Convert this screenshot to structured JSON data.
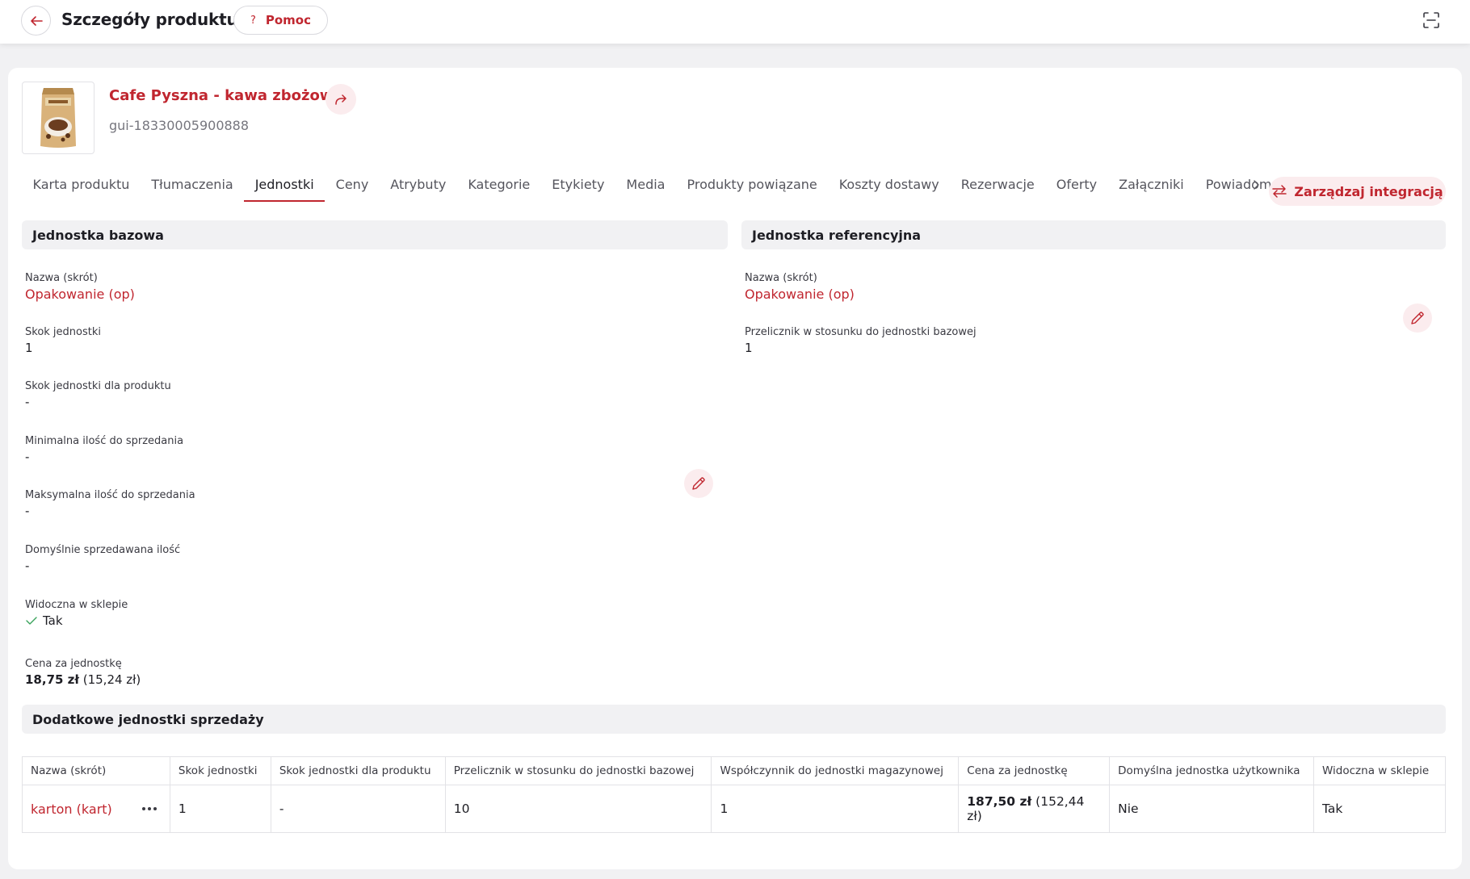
{
  "header": {
    "title": "Szczegóły produktu",
    "help_label": "Pomoc",
    "help_icon_glyph": "?"
  },
  "product": {
    "name": "Cafe Pyszna - kawa zbożowa",
    "code": "gui-18330005900888"
  },
  "tabs": [
    {
      "label": "Karta produktu"
    },
    {
      "label": "Tłumaczenia"
    },
    {
      "label": "Jednostki",
      "active": true
    },
    {
      "label": "Ceny"
    },
    {
      "label": "Atrybuty"
    },
    {
      "label": "Kategorie"
    },
    {
      "label": "Etykiety"
    },
    {
      "label": "Media"
    },
    {
      "label": "Produkty powiązane"
    },
    {
      "label": "Koszty dostawy"
    },
    {
      "label": "Rezerwacje"
    },
    {
      "label": "Oferty"
    },
    {
      "label": "Załączniki"
    },
    {
      "label": "Powiadom"
    }
  ],
  "integration_button": "Zarządzaj integracją",
  "base_unit": {
    "title": "Jednostka bazowa",
    "fields": [
      {
        "label": "Nazwa (skrót)",
        "value": "Opakowanie (op)"
      },
      {
        "label": "Skok jednostki",
        "value": "1"
      },
      {
        "label": "Skok jednostki dla produktu",
        "value": "-"
      },
      {
        "label": "Minimalna ilość do sprzedania",
        "value": "-"
      },
      {
        "label": "Maksymalna ilość do sprzedania",
        "value": "-"
      },
      {
        "label": "Domyślnie sprzedawana ilość",
        "value": "-"
      },
      {
        "label": "Widoczna w sklepie",
        "value": "Tak"
      },
      {
        "label": "Cena za jednostkę",
        "value_bold": "18,75 zł",
        "value_rest": " (15,24 zł)"
      }
    ]
  },
  "reference_unit": {
    "title": "Jednostka referencyjna",
    "fields": [
      {
        "label": "Nazwa (skrót)",
        "value": "Opakowanie (op)"
      },
      {
        "label": "Przelicznik w stosunku do jednostki bazowej",
        "value": "1"
      }
    ]
  },
  "additional_units": {
    "title": "Dodatkowe jednostki sprzedaży",
    "columns": [
      "Nazwa (skrót)",
      "Skok jednostki",
      "Skok jednostki dla produktu",
      "Przelicznik w stosunku do jednostki bazowej",
      "Współczynnik do jednostki magazynowej",
      "Cena za jednostkę",
      "Domyślna jednostka użytkownika",
      "Widoczna w sklepie"
    ],
    "rows": [
      {
        "name": "karton (kart)",
        "step": "1",
        "product_step": "-",
        "conversion": "10",
        "stock_factor": "1",
        "price_bold": "187,50 zł",
        "price_rest": " (152,44 zł)",
        "default_user_unit": "Nie",
        "visible": "Tak"
      }
    ]
  },
  "colors": {
    "accent": "#c0262f",
    "accent_light": "#fbecee",
    "section_bg": "#f1f1f3"
  }
}
